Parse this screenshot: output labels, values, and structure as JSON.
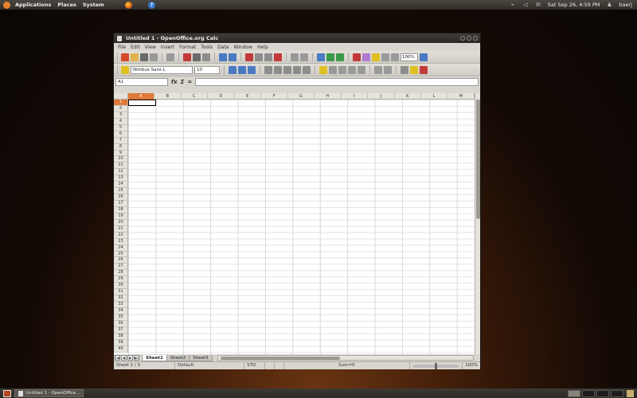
{
  "top_panel": {
    "menus": [
      "Applications",
      "Places",
      "System"
    ],
    "clock": "Sat Sep 26,  4:59 PM",
    "user": "baerj"
  },
  "window": {
    "title": "Untitled 1 - OpenOffice.org Calc",
    "menu": [
      "File",
      "Edit",
      "View",
      "Insert",
      "Format",
      "Tools",
      "Data",
      "Window",
      "Help"
    ],
    "zoom": "100%",
    "font_name": "Nimbus Sans L",
    "font_size": "10",
    "namebox": "A1",
    "formula_symbol": "fx",
    "sum_symbol": "Σ",
    "equals_symbol": "="
  },
  "grid": {
    "columns": [
      "A",
      "B",
      "C",
      "D",
      "E",
      "F",
      "G",
      "H",
      "I",
      "J",
      "K",
      "L",
      "M"
    ],
    "rows": [
      "1",
      "2",
      "3",
      "4",
      "5",
      "6",
      "7",
      "8",
      "9",
      "10",
      "11",
      "12",
      "13",
      "14",
      "15",
      "16",
      "17",
      "18",
      "19",
      "20",
      "21",
      "22",
      "23",
      "24",
      "25",
      "26",
      "27",
      "28",
      "29",
      "30",
      "31",
      "32",
      "33",
      "34",
      "35",
      "36",
      "37",
      "38",
      "39",
      "40"
    ],
    "active_column": "A",
    "active_row": "1"
  },
  "sheets": {
    "tabs": [
      "Sheet1",
      "Sheet2",
      "Sheet3"
    ],
    "active": "Sheet1"
  },
  "statusbar": {
    "sheet": "Sheet 1 / 3",
    "style": "Default",
    "mode": "STD",
    "sum": "Sum=0",
    "zoom": "100%"
  },
  "bottom_panel": {
    "task": "Untitled 1 - OpenOffice..."
  }
}
